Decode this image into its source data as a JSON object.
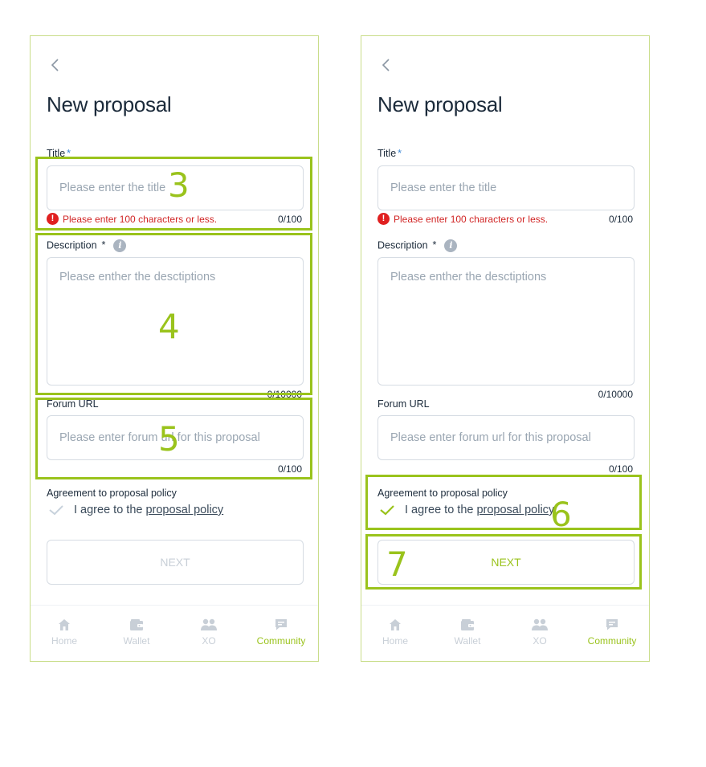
{
  "screens": [
    {
      "page_title": "New proposal",
      "title_label": "Title",
      "required_mark": "*",
      "title_placeholder": "Please enter the title",
      "title_error": "Please enter 100 characters or less.",
      "title_counter": "0/100",
      "description_label": "Description",
      "description_placeholder": "Please enther the desctiptions",
      "description_counter": "0/10000",
      "forum_label": "Forum URL",
      "forum_placeholder": "Please enter forum url for this proposal",
      "forum_counter": "0/100",
      "agreement_label": "Agreement to proposal policy",
      "agree_text": "I agree to the",
      "policy_link": "proposal policy",
      "next_label": "NEXT",
      "next_state": "disabled",
      "check_color": "#c8d2dc"
    },
    {
      "page_title": "New proposal",
      "title_label": "Title",
      "required_mark": "*",
      "title_placeholder": "Please enter the title",
      "title_error": "Please enter 100 characters or less.",
      "title_counter": "0/100",
      "description_label": "Description",
      "description_placeholder": "Please enther the desctiptions",
      "description_counter": "0/10000",
      "forum_label": "Forum URL",
      "forum_placeholder": "Please enter forum url for this proposal",
      "forum_counter": "0/100",
      "agreement_label": "Agreement to proposal policy",
      "agree_text": "I agree to the",
      "policy_link": "proposal policy",
      "next_label": "NEXT",
      "next_state": "enabled",
      "check_color": "#9ac31c"
    }
  ],
  "nav": {
    "items": [
      "Home",
      "Wallet",
      "XO",
      "Community"
    ],
    "active": "Community",
    "icons": [
      "home-icon",
      "wallet-icon",
      "people-icon",
      "chat-icon"
    ]
  },
  "annotations": [
    "3",
    "4",
    "5",
    "6",
    "7"
  ],
  "colors": {
    "accent": "#9ac31c",
    "error": "#d12525",
    "frame": "#c9dd8a",
    "muted": "#c8cfd7"
  }
}
